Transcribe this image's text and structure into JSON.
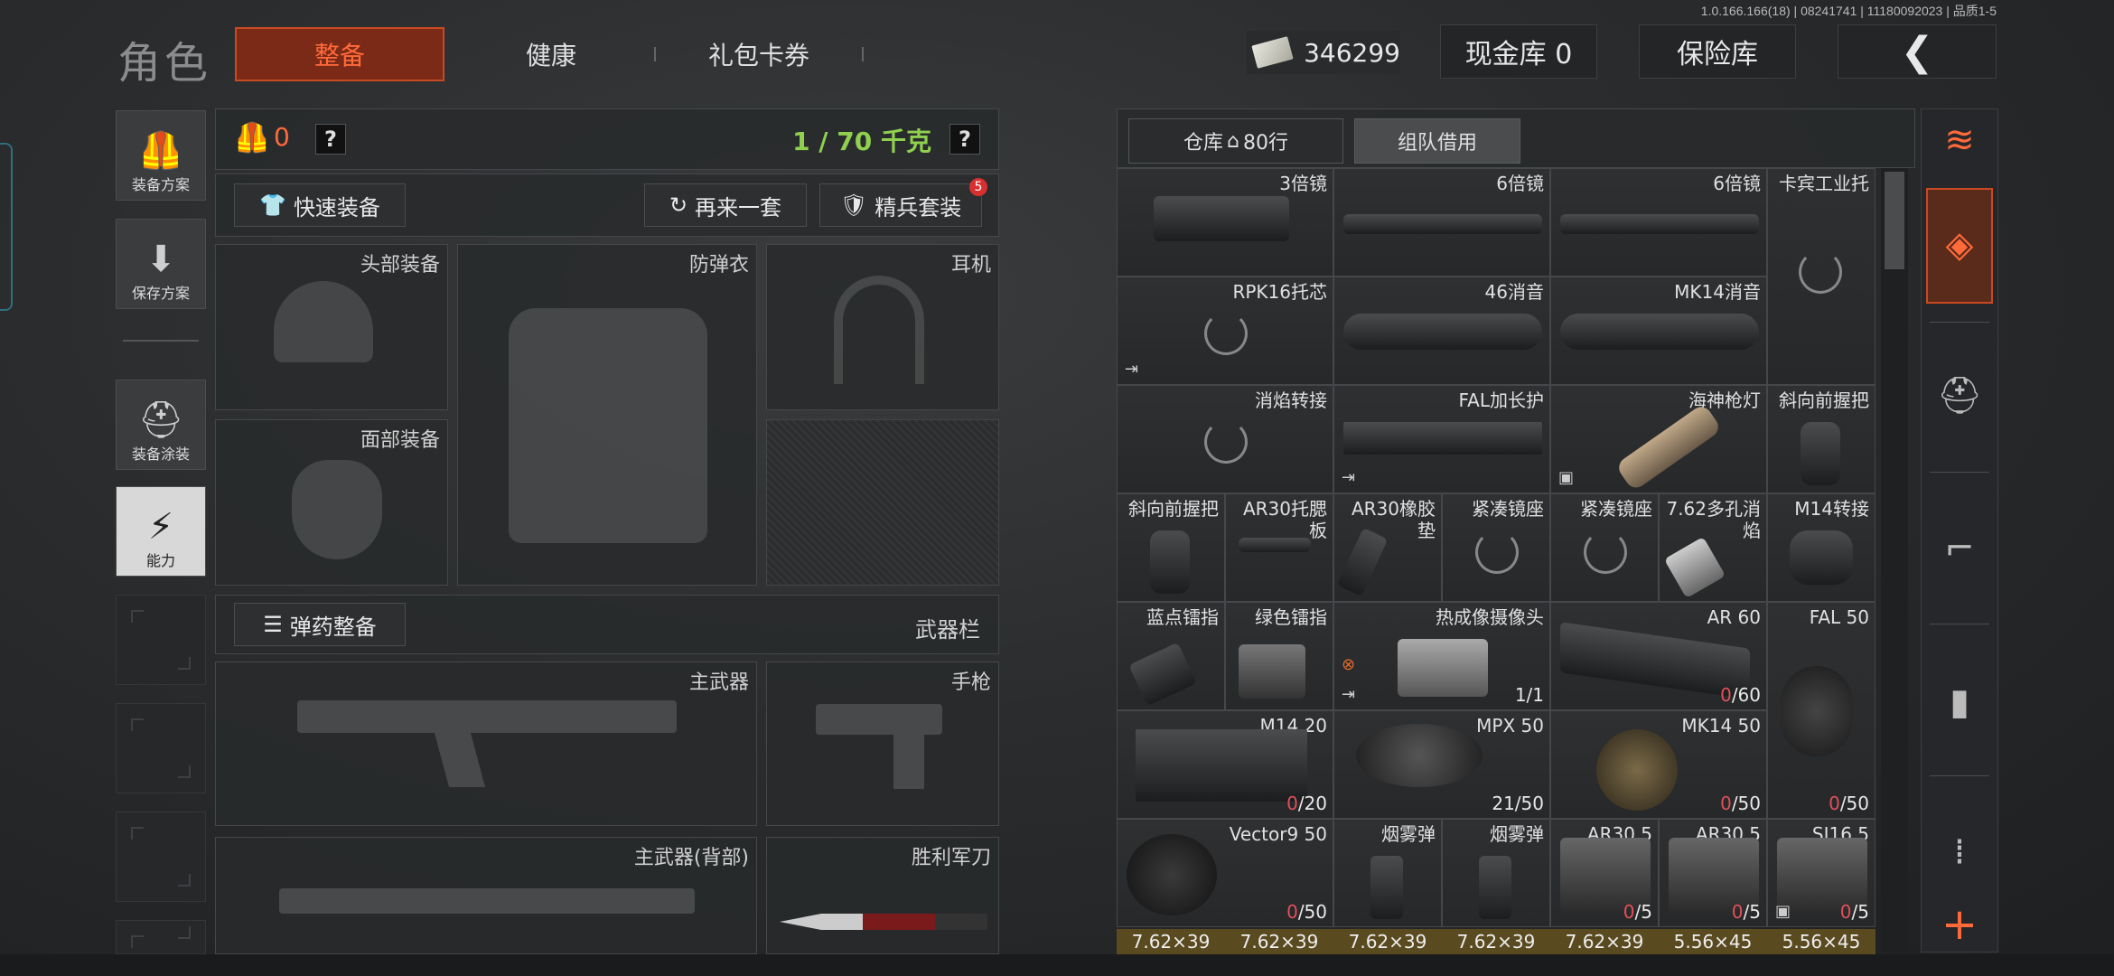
{
  "version": "1.0.166.166(18) | 08241741 | 11180092023 | 品质1-5",
  "header": {
    "title": "角色",
    "tabs": [
      "整备",
      "健康",
      "礼包卡券"
    ],
    "currency": "346299",
    "cash_vault": "现金库 0",
    "insurance": "保险库"
  },
  "left_menu": {
    "loadout_plan": "装备方案",
    "save_plan": "保存方案",
    "paint": "装备涂装",
    "ability": "能力"
  },
  "equip": {
    "armor_count": "0",
    "weight": "1 / 70 千克",
    "quick_equip": "快速装备",
    "again": "再来一套",
    "elite": "精兵套装",
    "elite_badge": "5",
    "slots": {
      "head": "头部装备",
      "vest": "防弹衣",
      "ear": "耳机",
      "face": "面部装备"
    },
    "ammo_btn": "弹药整备",
    "weapon_bar": "武器栏",
    "primary": "主武器",
    "pistol": "手枪",
    "primary_back": "主武器(背部)",
    "knife": "胜利军刀"
  },
  "inventory": {
    "warehouse": "仓库",
    "rows": "80行",
    "team_borrow": "组队借用",
    "row1": [
      "3倍镜",
      "6倍镜",
      "6倍镜",
      "卡宾工业托"
    ],
    "row2": [
      "RPK16托芯",
      "46消音",
      "MK14消音"
    ],
    "row3": [
      "消焰转接",
      "FAL加长护",
      "海神枪灯",
      "斜向前握把"
    ],
    "row4": [
      "斜向前握把",
      "AR30托腮板",
      "AR30橡胶垫",
      "紧凑镜座",
      "紧凑镜座",
      "7.62多孔消焰",
      "M14转接"
    ],
    "row5": [
      "蓝点镭指",
      "绿色镭指",
      "热成像摄像头",
      "AR 60",
      "FAL 50"
    ],
    "row5_counts": {
      "thermal": "1/1",
      "ar60_zero": "0",
      "ar60_cap": "/60"
    },
    "row6": [
      "M14 20",
      "MPX 50",
      "MK14 50"
    ],
    "row6_counts": {
      "m14_zero": "0",
      "m14_cap": "/20",
      "mpx": "21/50",
      "mk14_zero": "0",
      "mk14_cap": "/50",
      "fal_zero": "0",
      "fal_cap": "/50"
    },
    "row7": [
      "Vector9 50",
      "烟雾弹",
      "烟雾弹",
      "AR30 5",
      "AR30 5",
      "SJ16 5"
    ],
    "row7_counts": {
      "v_zero": "0",
      "v_cap": "/50",
      "a_zero": "0",
      "a_cap": "/5"
    },
    "ammo": [
      "7.62×39",
      "7.62×39",
      "7.62×39",
      "7.62×39",
      "7.62×39",
      "5.56×45",
      "5.56×45"
    ]
  },
  "colors": {
    "accent": "#c94a22",
    "weight_green": "#8fd14f",
    "zero_red": "#e0505a"
  }
}
